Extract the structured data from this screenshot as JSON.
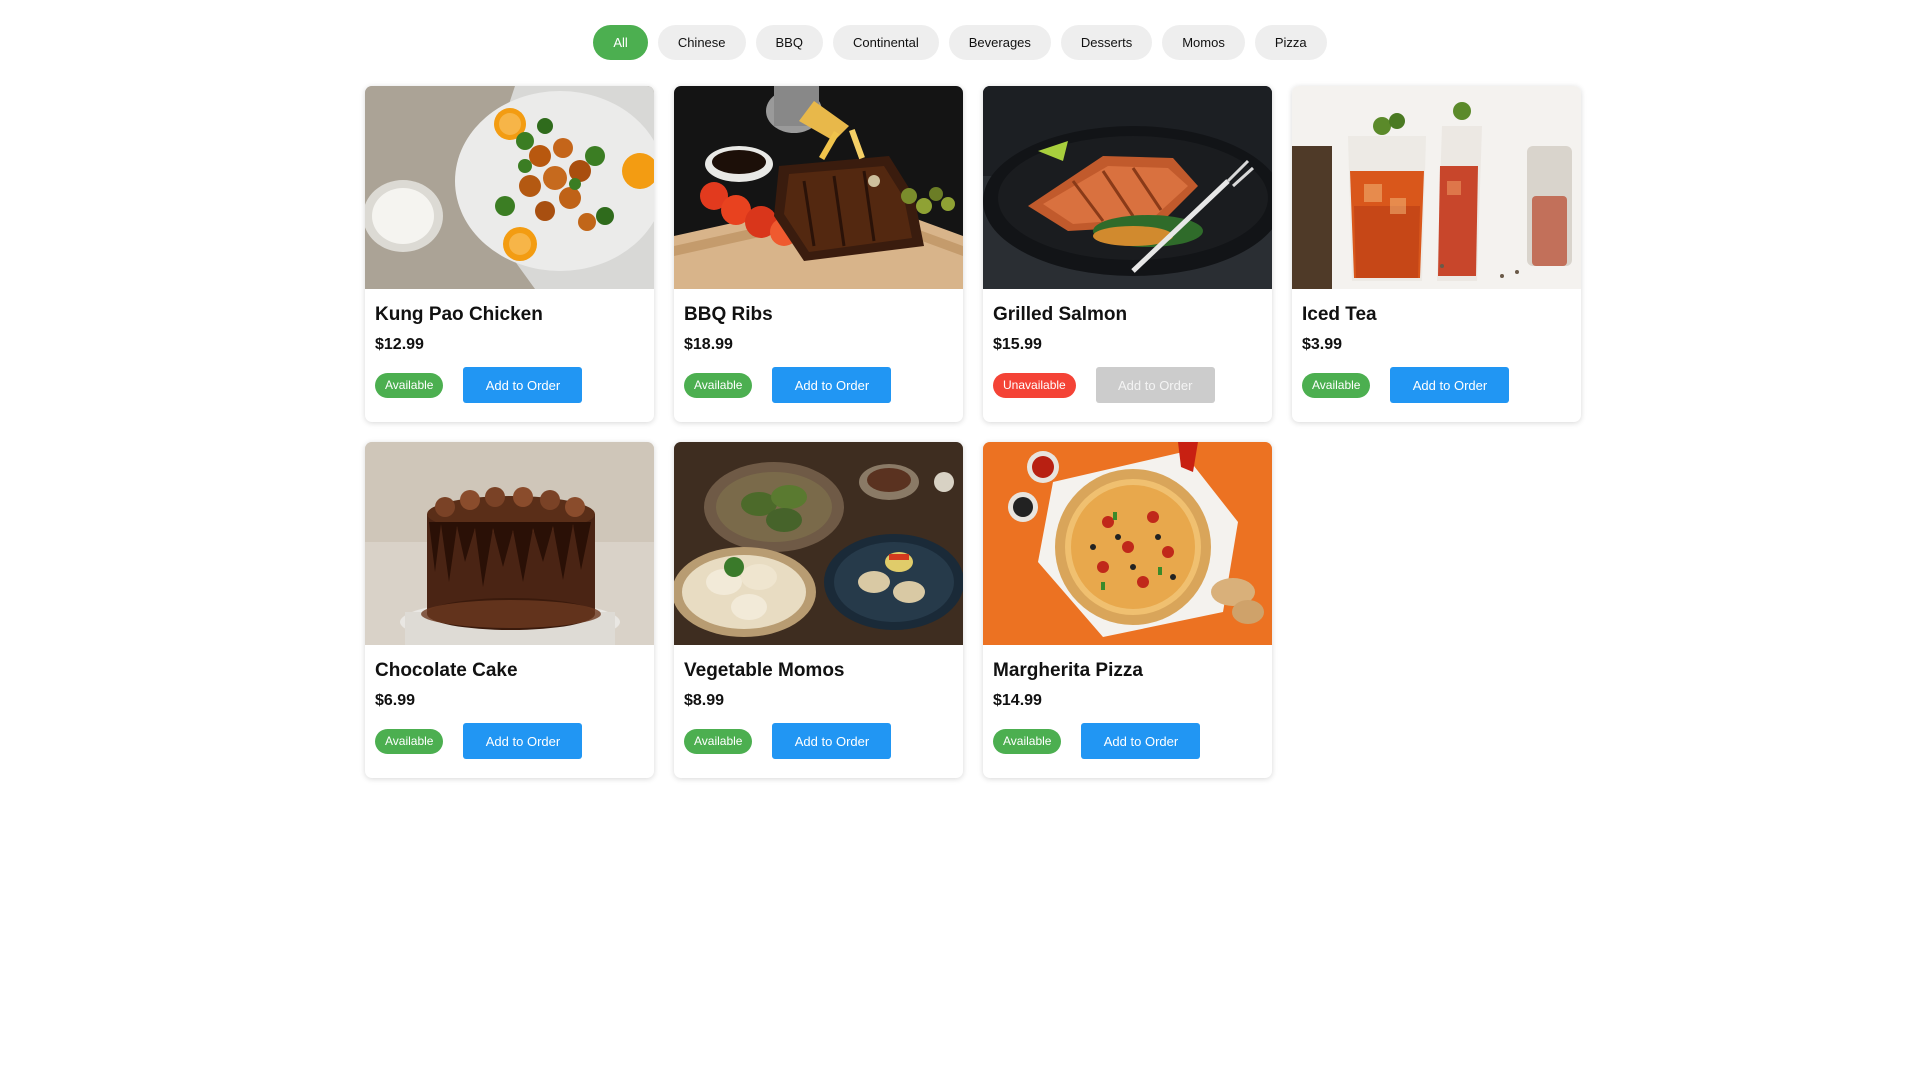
{
  "filters": [
    "All",
    "Chinese",
    "BBQ",
    "Continental",
    "Beverages",
    "Desserts",
    "Momos",
    "Pizza"
  ],
  "active_filter": "All",
  "colors": {
    "accent_green": "#4caf50",
    "button_blue": "#2196f3",
    "unavailable_red": "#f44336",
    "disabled_gray": "#cccccc"
  },
  "menu_items": [
    {
      "name": "Kung Pao Chicken",
      "price": "$12.99",
      "status": "Available",
      "button": "Add to Order",
      "available": true,
      "image": "kung-pao-chicken-photo"
    },
    {
      "name": "BBQ Ribs",
      "price": "$18.99",
      "status": "Available",
      "button": "Add to Order",
      "available": true,
      "image": "bbq-ribs-photo"
    },
    {
      "name": "Grilled Salmon",
      "price": "$15.99",
      "status": "Unavailable",
      "button": "Add to Order",
      "available": false,
      "image": "grilled-salmon-photo"
    },
    {
      "name": "Iced Tea",
      "price": "$3.99",
      "status": "Available",
      "button": "Add to Order",
      "available": true,
      "image": "iced-tea-photo"
    },
    {
      "name": "Chocolate Cake",
      "price": "$6.99",
      "status": "Available",
      "button": "Add to Order",
      "available": true,
      "image": "chocolate-cake-photo"
    },
    {
      "name": "Vegetable Momos",
      "price": "$8.99",
      "status": "Available",
      "button": "Add to Order",
      "available": true,
      "image": "vegetable-momos-photo"
    },
    {
      "name": "Margherita Pizza",
      "price": "$14.99",
      "status": "Available",
      "button": "Add to Order",
      "available": true,
      "image": "margherita-pizza-photo"
    }
  ]
}
